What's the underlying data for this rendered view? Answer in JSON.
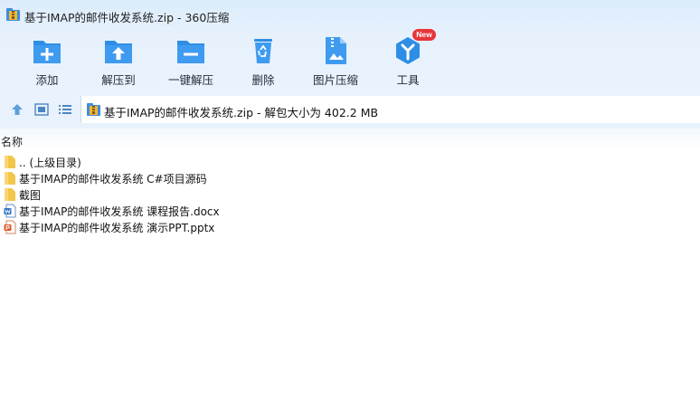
{
  "window": {
    "title": "基于IMAP的邮件收发系统.zip - 360压缩",
    "icon": "zip-archive-icon"
  },
  "toolbar": {
    "items": [
      {
        "label": "添加",
        "icon": "add-folder-icon"
      },
      {
        "label": "解压到",
        "icon": "extract-to-folder-icon"
      },
      {
        "label": "一键解压",
        "icon": "one-click-extract-icon"
      },
      {
        "label": "删除",
        "icon": "recycle-bin-icon"
      },
      {
        "label": "图片压缩",
        "icon": "image-compress-icon"
      },
      {
        "label": "工具",
        "icon": "tools-icon",
        "badge": "New"
      }
    ]
  },
  "nav": {
    "up_icon": "arrow-up-icon",
    "view1_icon": "thumbnail-view-icon",
    "view2_icon": "list-view-icon"
  },
  "address": {
    "text": "基于IMAP的邮件收发系统.zip - 解包大小为 402.2 MB"
  },
  "list": {
    "column_name": "名称",
    "rows": [
      {
        "name": ".. (上级目录)",
        "type": "folder"
      },
      {
        "name": "基于IMAP的邮件收发系统 C#项目源码",
        "type": "folder"
      },
      {
        "name": "截图",
        "type": "folder"
      },
      {
        "name": "基于IMAP的邮件收发系统 课程报告.docx",
        "type": "docx"
      },
      {
        "name": "基于IMAP的邮件收发系统 演示PPT.pptx",
        "type": "pptx"
      }
    ]
  },
  "colors": {
    "toolbar_blue": "#2e8ee6",
    "badge_red": "#e8343b",
    "folder_yellow": "#f5c54a"
  }
}
